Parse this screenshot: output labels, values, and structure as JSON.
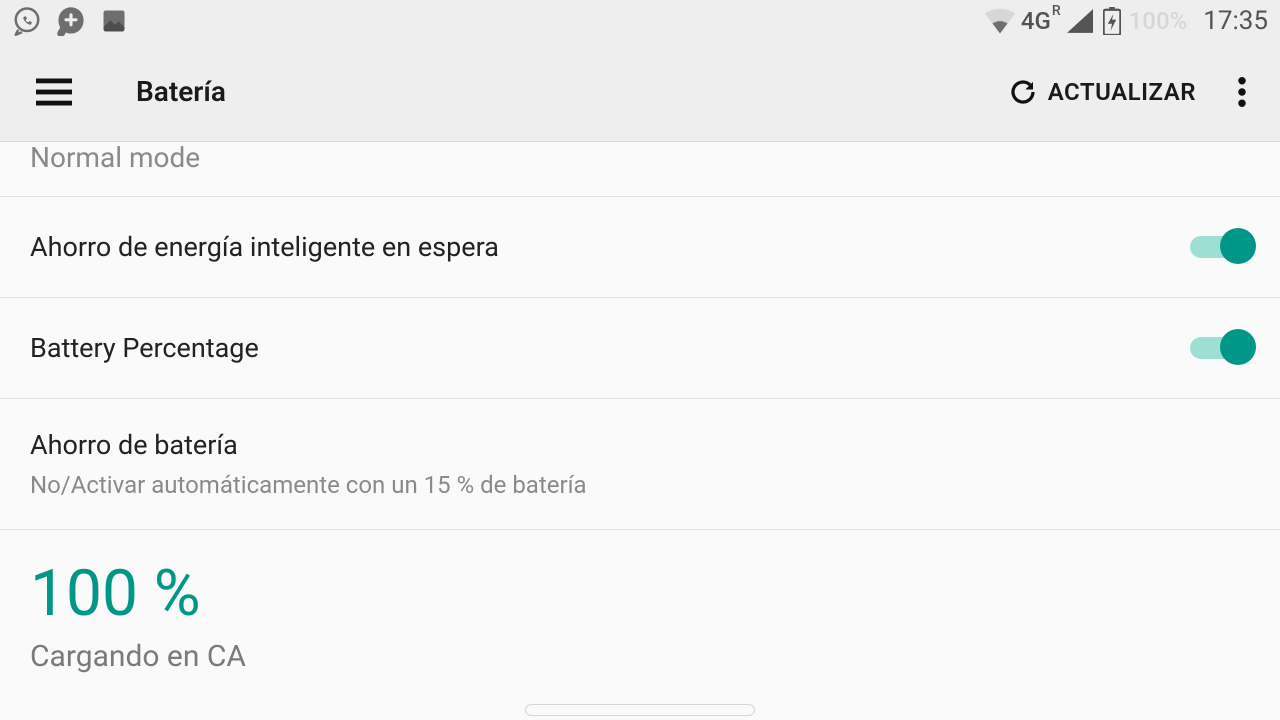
{
  "statusbar": {
    "network_label": "4G",
    "network_sup": "R",
    "battery_pct": "100%",
    "time": "17:35"
  },
  "appbar": {
    "title": "Batería",
    "refresh_label": "ACTUALIZAR"
  },
  "partial_mode_subtitle": "Normal mode",
  "rows": {
    "smart_standby": {
      "label": "Ahorro de energía inteligente en espera"
    },
    "battery_pct_toggle": {
      "label": "Battery Percentage"
    },
    "battery_saver": {
      "label": "Ahorro de batería",
      "sub": "No/Activar automáticamente con un 15 % de batería"
    }
  },
  "charge": {
    "value": "100 %",
    "sub": "Cargando en CA"
  }
}
